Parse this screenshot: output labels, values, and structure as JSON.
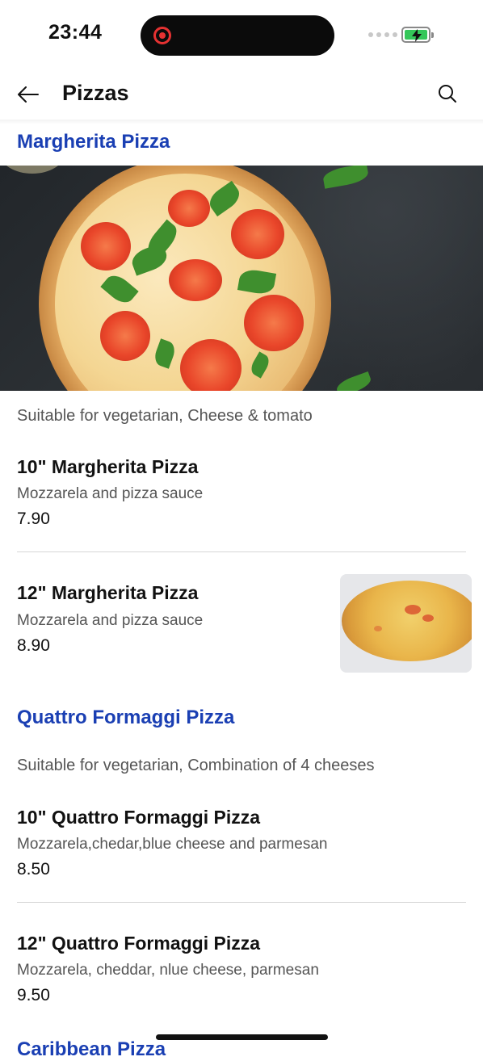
{
  "status_bar": {
    "time": "23:44"
  },
  "header": {
    "title": "Pizzas"
  },
  "sections": [
    {
      "title": "Margherita Pizza",
      "description": "Suitable for vegetarian, Cheese & tomato",
      "items": [
        {
          "name": "10\" Margherita Pizza",
          "description": "Mozzarela and pizza sauce",
          "price": "7.90"
        },
        {
          "name": "12\" Margherita Pizza",
          "description": "Mozzarela and pizza sauce",
          "price": "8.90"
        }
      ]
    },
    {
      "title": "Quattro Formaggi Pizza",
      "description": "Suitable for vegetarian, Combination of 4 cheeses",
      "items": [
        {
          "name": "10\" Quattro Formaggi Pizza",
          "description": "Mozzarela,chedar,blue cheese and parmesan",
          "price": "8.50"
        },
        {
          "name": "12\" Quattro Formaggi Pizza",
          "description": "Mozzarela, cheddar, nlue cheese, parmesan",
          "price": "9.50"
        }
      ]
    },
    {
      "title": "Caribbean Pizza"
    }
  ],
  "colors": {
    "section_title": "#1a3fb3",
    "accent_battery": "#34c759"
  }
}
